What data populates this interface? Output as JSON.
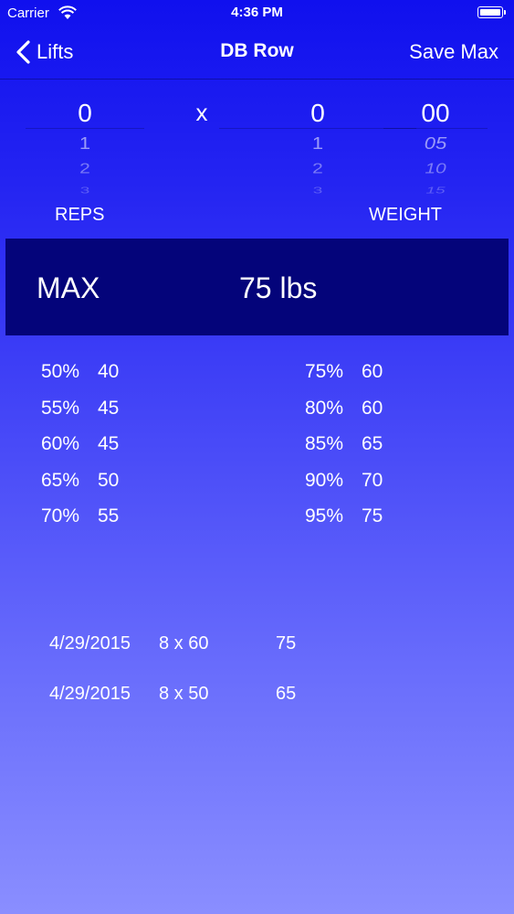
{
  "status_bar": {
    "carrier": "Carrier",
    "time": "4:36 PM"
  },
  "nav": {
    "back_label": "Lifts",
    "title": "DB Row",
    "save_label": "Save Max"
  },
  "picker": {
    "reps": [
      "0",
      "1",
      "2",
      "3"
    ],
    "separator": "x",
    "weight_whole": [
      "0",
      "1",
      "2",
      "3"
    ],
    "weight_fraction": [
      "00",
      "05",
      "10",
      "15"
    ],
    "reps_label": "REPS",
    "weight_label": "WEIGHT"
  },
  "max": {
    "label": "MAX",
    "value": "75 lbs"
  },
  "percentages": {
    "left": [
      {
        "pct": "50%",
        "value": "40"
      },
      {
        "pct": "55%",
        "value": "45"
      },
      {
        "pct": "60%",
        "value": "45"
      },
      {
        "pct": "65%",
        "value": "50"
      },
      {
        "pct": "70%",
        "value": "55"
      }
    ],
    "right": [
      {
        "pct": "75%",
        "value": "60"
      },
      {
        "pct": "80%",
        "value": "60"
      },
      {
        "pct": "85%",
        "value": "65"
      },
      {
        "pct": "90%",
        "value": "70"
      },
      {
        "pct": "95%",
        "value": "75"
      }
    ]
  },
  "history": [
    {
      "date": "4/29/2015",
      "set": "8 x 60",
      "max": "75"
    },
    {
      "date": "4/29/2015",
      "set": "8 x 50",
      "max": "65"
    }
  ],
  "colors": {
    "max_panel": "#04047a",
    "accent": "#1010ee",
    "text": "#ffffff"
  }
}
